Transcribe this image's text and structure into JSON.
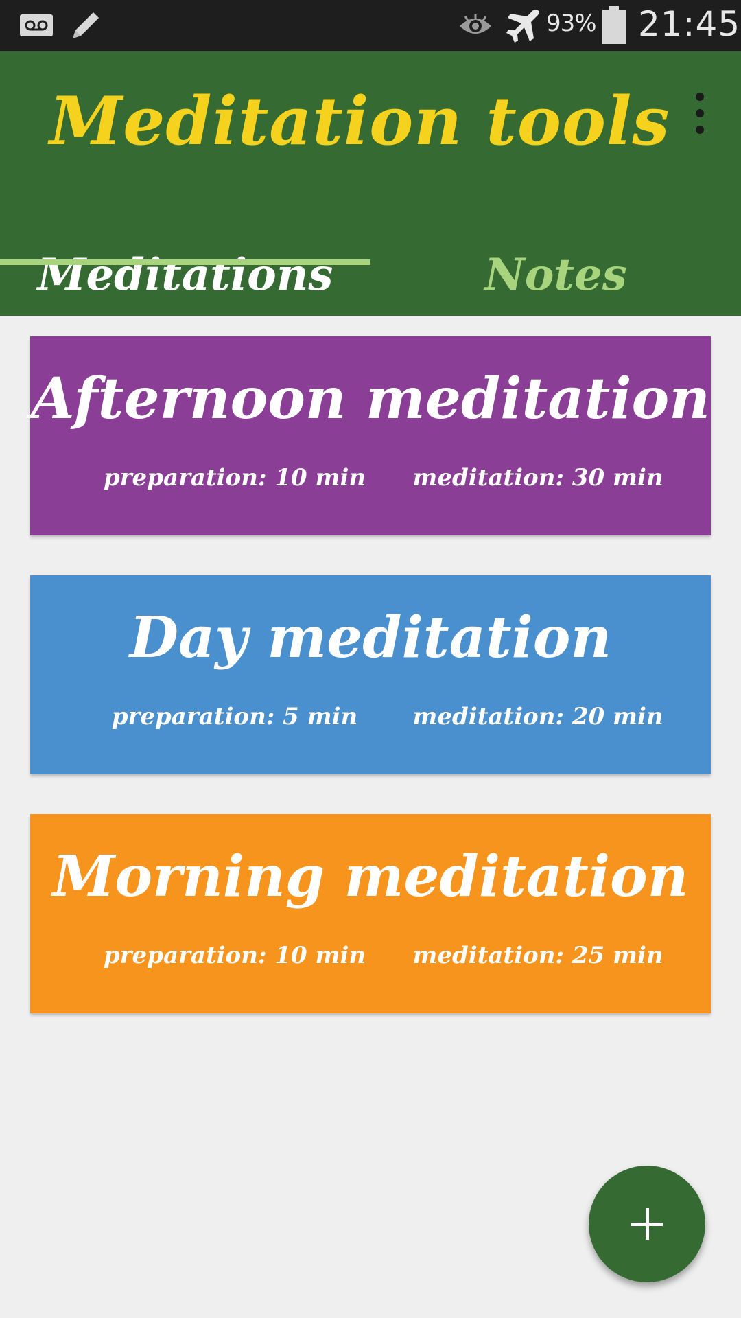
{
  "status_bar": {
    "battery_percent": "93%",
    "time": "21:45",
    "icons": [
      "voicemail-icon",
      "pencil-icon",
      "eye-icon",
      "airplane-mode-icon",
      "battery-icon"
    ]
  },
  "app_bar": {
    "title": "Meditation tools",
    "menu_icon": "more-vert-icon"
  },
  "tabs": [
    {
      "label": "Meditations",
      "selected": true
    },
    {
      "label": "Notes",
      "selected": false
    }
  ],
  "meditations": [
    {
      "title": "Afternoon meditation",
      "preparation": "preparation: 10 min",
      "meditation": "meditation: 30 min",
      "color": "#8b3e96"
    },
    {
      "title": "Day meditation",
      "preparation": "preparation: 5 min",
      "meditation": "meditation: 20 min",
      "color": "#4a8fce"
    },
    {
      "title": "Morning meditation",
      "preparation": "preparation: 10 min",
      "meditation": "meditation: 25 min",
      "color": "#f7941d"
    }
  ],
  "fab": {
    "icon": "plus-icon"
  },
  "colors": {
    "primary": "#356b32",
    "title_yellow": "#f5d21d",
    "tab_accent": "#a8d47e",
    "background": "#efefef"
  }
}
